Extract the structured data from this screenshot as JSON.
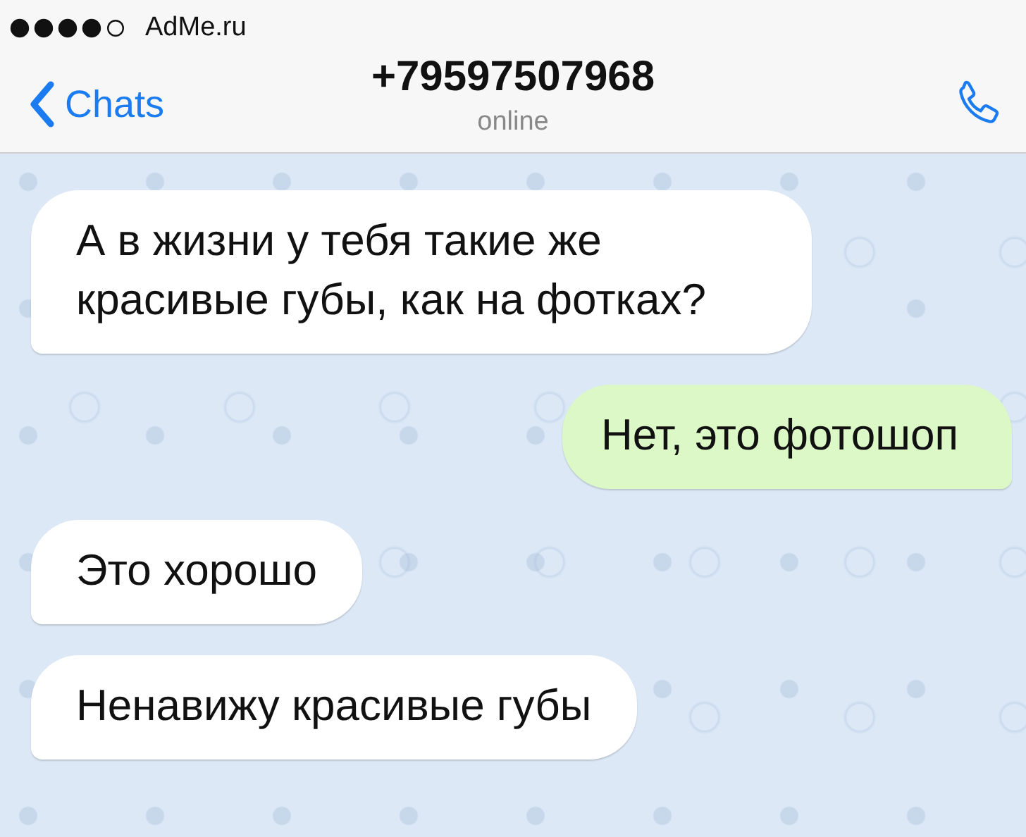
{
  "status_bar": {
    "carrier": "AdMe.ru"
  },
  "header": {
    "back_label": "Chats",
    "title": "+79597507968",
    "subtitle": "online"
  },
  "messages": [
    {
      "kind": "incoming",
      "text": "А в жизни у тебя такие же красивые губы, как на фотках?"
    },
    {
      "kind": "outgoing",
      "text": "Нет, это фотошоп"
    },
    {
      "kind": "incoming",
      "text": "Это хорошо"
    },
    {
      "kind": "incoming",
      "text": "Ненавижу красивые губы"
    }
  ]
}
